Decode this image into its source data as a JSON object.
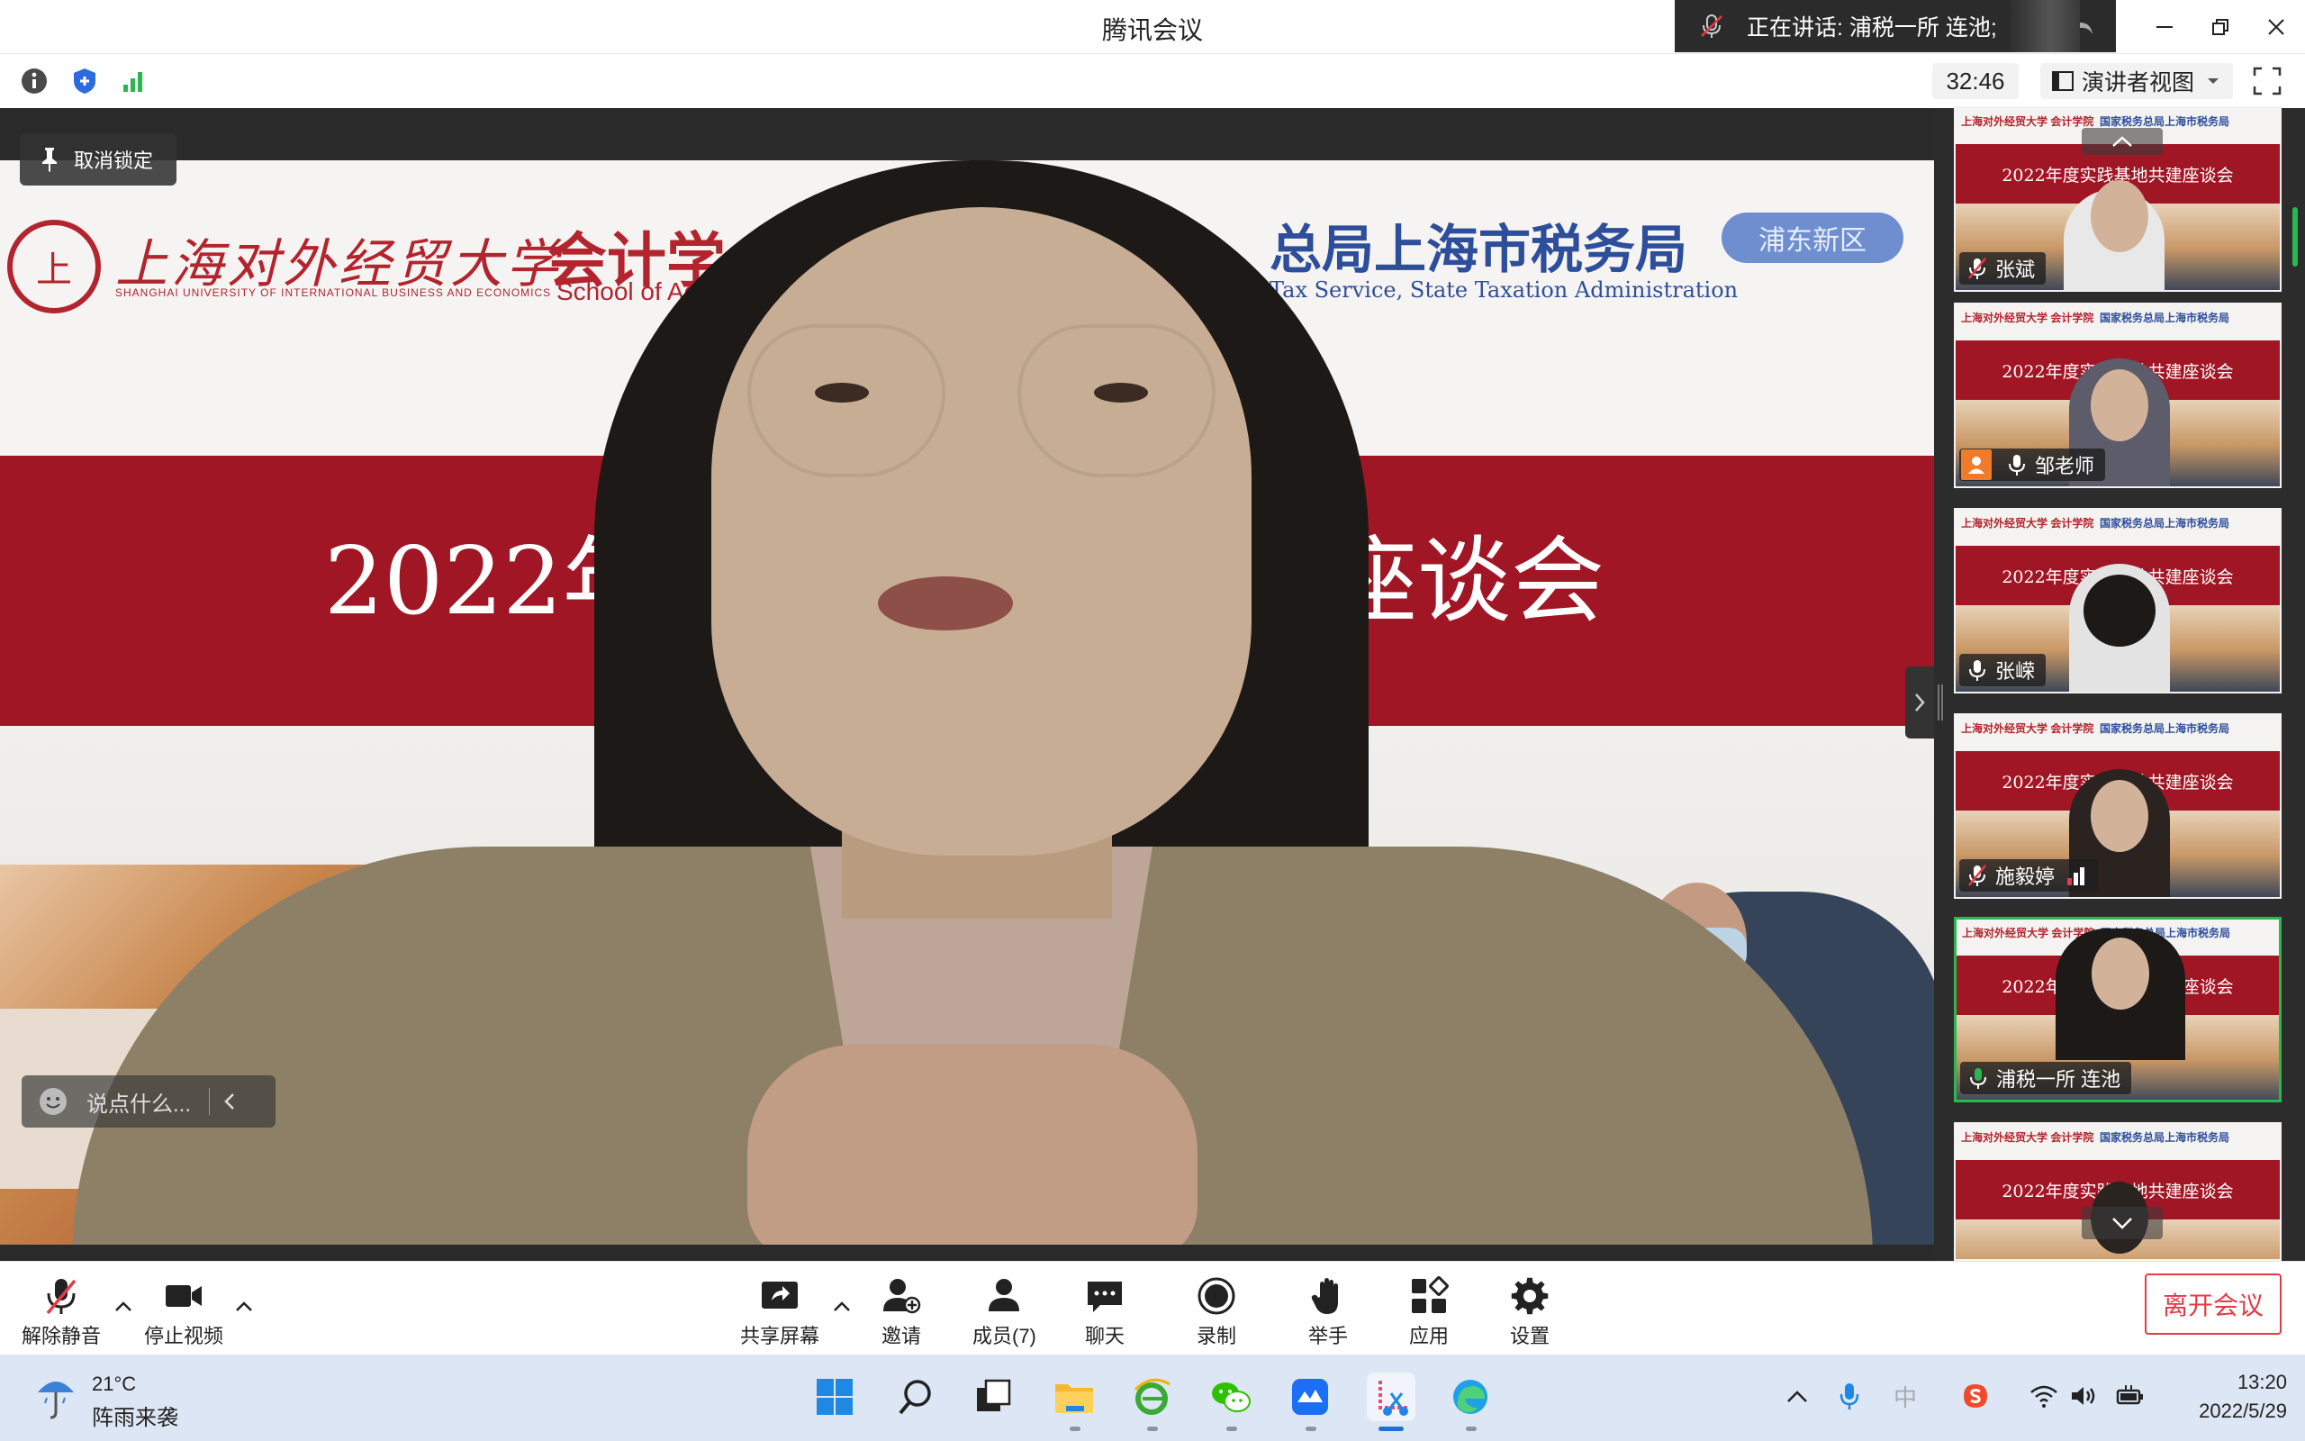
{
  "window": {
    "title": "腾讯会议",
    "speaking_text": "正在讲话: 浦税一所 连池;"
  },
  "infobar": {
    "timer": "32:46",
    "view_mode": "演讲者视图"
  },
  "main_video": {
    "unlock_label": "取消锁定",
    "chat_placeholder": "说点什么...",
    "banner": {
      "university_cn": "上海对外经贸大学",
      "university_en": "SHANGHAI UNIVERSITY OF INTERNATIONAL BUSINESS AND ECONOMICS",
      "school_cn": "会计学",
      "school_en": "School of Acc",
      "tax_bureau_cn": "总局上海市税务局",
      "tax_bureau_en": "Tax Service, State Taxation Administration",
      "district_badge": "浦东新区",
      "title_left": "2022年度",
      "title_right": "座谈会",
      "seal_char": "上"
    }
  },
  "participants": [
    {
      "name": "张斌",
      "title": "2022年度实践基地共建座谈会",
      "mic": "muted",
      "active": false
    },
    {
      "name": "邹老师",
      "title": "2022年度实践基地共建座谈会",
      "mic": "on",
      "active": false,
      "avatar": true
    },
    {
      "name": "张嵘",
      "title": "2022年度实践基地共建座谈会",
      "mic": "on",
      "active": false
    },
    {
      "name": "施毅婷",
      "title": "2022年度实践基地共建座谈会",
      "mic": "muted",
      "active": false,
      "signal": true
    },
    {
      "name": "浦税一所 连池",
      "title": "2022年度实践基地共建座谈会",
      "mic": "speaking",
      "active": true
    },
    {
      "name": "",
      "title": "2022年度实践基地共建座谈会",
      "mic": "none",
      "active": false
    }
  ],
  "tile_logos": {
    "left": "上海对外经贸大学  会计学院",
    "right": "国家税务总局上海市税务局"
  },
  "toolbar": {
    "unmute": "解除静音",
    "stop_video": "停止视频",
    "share_screen": "共享屏幕",
    "invite": "邀请",
    "members": "成员(7)",
    "chat": "聊天",
    "record": "录制",
    "raise_hand": "举手",
    "apps": "应用",
    "settings": "设置",
    "leave": "离开会议"
  },
  "taskbar": {
    "temperature": "21°C",
    "weather": "阵雨来袭",
    "ime": "中",
    "time": "13:20",
    "date": "2022/5/29"
  },
  "colors": {
    "accent_green": "#29b84f",
    "leave_red": "#e63946",
    "banner_red": "#a01624",
    "tax_blue": "#2d4e9b"
  }
}
